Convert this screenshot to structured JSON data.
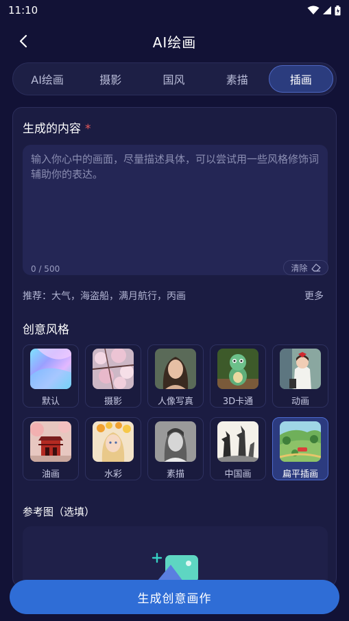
{
  "status_bar": {
    "time": "11:10"
  },
  "header": {
    "title": "AI绘画"
  },
  "tabs": [
    {
      "label": "AI绘画",
      "active": false
    },
    {
      "label": "摄影",
      "active": false
    },
    {
      "label": "国风",
      "active": false
    },
    {
      "label": "素描",
      "active": false
    },
    {
      "label": "插画",
      "active": true
    }
  ],
  "content": {
    "title": "生成的内容",
    "required_mark": "*",
    "placeholder": "输入你心中的画面，尽量描述具体，可以尝试用一些风格修饰词辅助你的表达。",
    "counter": "0 / 500",
    "clear_label": "清除",
    "recommend": "推荐：大气，海盗船，满月航行，丙画",
    "more_label": "更多"
  },
  "styles": {
    "title": "创意风格",
    "items": [
      {
        "label": "默认",
        "active": false
      },
      {
        "label": "摄影",
        "active": false
      },
      {
        "label": "人像写真",
        "active": false
      },
      {
        "label": "3D卡通",
        "active": false
      },
      {
        "label": "动画",
        "active": false
      },
      {
        "label": "油画",
        "active": false
      },
      {
        "label": "水彩",
        "active": false
      },
      {
        "label": "素描",
        "active": false
      },
      {
        "label": "中国画",
        "active": false
      },
      {
        "label": "扁平插画",
        "active": true
      }
    ]
  },
  "reference": {
    "title": "参考图（选填）"
  },
  "generate_button": {
    "label": "生成创意画作"
  },
  "colors": {
    "accent": "#2f6dd6",
    "background": "#121236",
    "required": "#e85a5a"
  }
}
